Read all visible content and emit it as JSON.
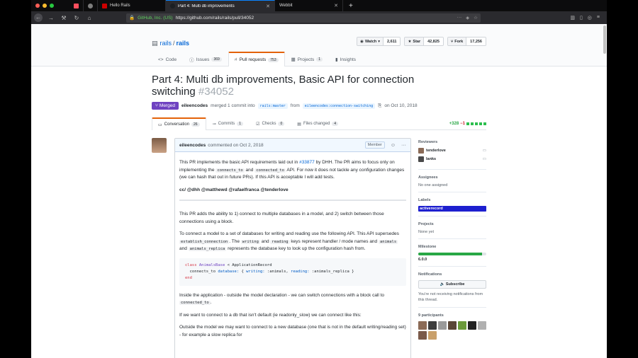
{
  "browser": {
    "tabs": [
      {
        "label": "",
        "color": "#ff4f5e"
      },
      {
        "label": "",
        "color": "#7d7d7d"
      },
      {
        "label": "Hello Rails",
        "color": "#cc0000"
      },
      {
        "label": "Part 4: Multi db improvements",
        "color": "#1b1f23",
        "active": true
      },
      {
        "label": "Webbit",
        "color": "#555555"
      }
    ],
    "url_org": "GitHub, Inc. (US)",
    "url": "https://github.com/rails/rails/pull/34052"
  },
  "repo": {
    "owner": "rails",
    "name": "rails",
    "watch_label": "Watch",
    "watch_count": "2,611",
    "star_label": "Star",
    "star_count": "42,825",
    "fork_label": "Fork",
    "fork_count": "17,256",
    "nav": [
      {
        "label": "Code",
        "icon": "code-icon",
        "count": ""
      },
      {
        "label": "Issues",
        "icon": "issue-icon",
        "count": "369"
      },
      {
        "label": "Pull requests",
        "icon": "pull-request-icon",
        "count": "753"
      },
      {
        "label": "Projects",
        "icon": "project-icon",
        "count": "1"
      },
      {
        "label": "Insights",
        "icon": "graph-icon",
        "count": ""
      }
    ]
  },
  "pr": {
    "title": "Part 4: Multi db improvements, Basic API for connection switching",
    "number": "#34052",
    "state": "Merged",
    "author": "eileencodes",
    "merged_text": "merged 1 commit into",
    "base_branch": "rails:master",
    "from_text": "from",
    "head_branch": "eileencodes:connection-switching",
    "date": "on Oct 10, 2018",
    "tabs": [
      {
        "label": "Conversation",
        "count": "26",
        "icon": "comment-icon"
      },
      {
        "label": "Commits",
        "count": "1",
        "icon": "commit-icon"
      },
      {
        "label": "Checks",
        "count": "0",
        "icon": "checks-icon"
      },
      {
        "label": "Files changed",
        "count": "4",
        "icon": "file-diff-icon"
      }
    ],
    "additions": "+328",
    "deletions": "−1"
  },
  "comment": {
    "author": "eileencodes",
    "commented": "commented on Oct 2, 2018",
    "badge": "Member",
    "p1_a": "This PR implements the basic API requirements laid out in ",
    "p1_link": "#33877",
    "p1_b": " by DHH. The PR aims to focus only on implementing the ",
    "code_connects_to": "connects_to",
    "and": " and ",
    "code_connected_to": "connected_to",
    "p1_c": " API. For now it does not tackle any configuration changes (we can hash that out in future PRs). If this API is acceptable I will add tests.",
    "cc": "cc/ @dhh @matthewd @rafaelfranca @tenderlove",
    "p2": "This PR adds the ability to 1) connect to multiple databases in a model, and 2) switch between those connections using a block.",
    "p3_a": "To connect a model to a set of databases for writing and reading use the following API. This API supersedes ",
    "code_establish": "establish_connection",
    "p3_b": ". The ",
    "code_writing": "writing",
    "p3_c": " and ",
    "code_reading": "reading",
    "p3_d": " keys represent handler / mode names and ",
    "code_animals": "animals",
    "p3_e": " and ",
    "code_animals_replica": "animals_replica",
    "p3_f": " represents the database key to look up the configuration hash from.",
    "code_line1_kw": "class",
    "code_line1_cl": "AnimalsBase",
    "code_line1_rest": " < ApplicationRecord",
    "code_line2_a": "  connects_to ",
    "code_line2_b": "database:",
    "code_line2_c": " { ",
    "code_line2_d": "writing:",
    "code_line2_e": " :animals, ",
    "code_line2_f": "reading:",
    "code_line2_g": " :animals_replica }",
    "code_line3": "end",
    "p4_a": "Inside the application - outside the model declaration - we can switch connections with a block call to ",
    "code_connected_to2": "connected_to",
    "p4_b": ".",
    "p5": "If we want to connect to a db that isn't default (ie readonly_slow) we can connect like this:",
    "p6": "Outside the model we may want to connect to a new database (one that is not in the default writing/reading set) - for example a slow replica for"
  },
  "sidebar": {
    "reviewers_h": "Reviewers",
    "reviewers": [
      {
        "name": "tenderlove"
      },
      {
        "name": "lanks"
      }
    ],
    "assignees_h": "Assignees",
    "assignees": "No one assigned",
    "labels_h": "Labels",
    "label": "activerecord",
    "label_color": "#1d1fcf",
    "projects_h": "Projects",
    "projects": "None yet",
    "milestone_h": "Milestone",
    "milestone_progress": 0.94,
    "milestone": "6.0.0",
    "notifications_h": "Notifications",
    "subscribe": "Subscribe",
    "notif_text": "You're not receiving notifications from this thread.",
    "participants_h": "9 participants"
  }
}
